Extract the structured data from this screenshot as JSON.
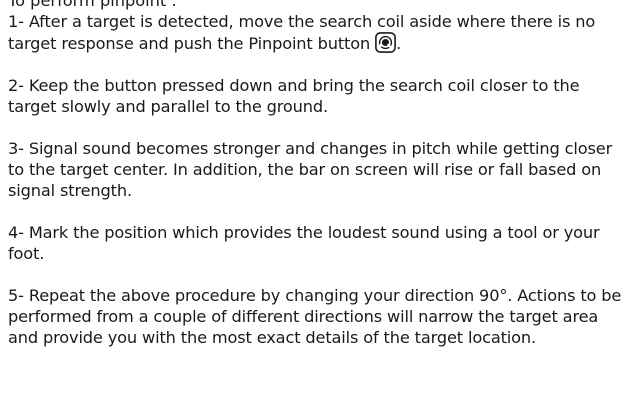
{
  "document": {
    "heading": "To perform pinpoint :",
    "steps": [
      {
        "text_before_icon": "1- After a target is detected, move the search coil aside where there is no target response and push the Pinpoint button",
        "icon": "pinpoint-button-icon",
        "text_after_icon": "."
      },
      {
        "text": "2- Keep the button pressed down and bring the search coil closer to the target slowly and parallel to the ground."
      },
      {
        "text": "3- Signal sound becomes stronger and changes in pitch while getting closer to the target center. In addition, the bar on screen will rise or fall based on signal strength."
      },
      {
        "text": "4- Mark the position which provides the loudest sound using a tool or your foot."
      },
      {
        "text": "5- Repeat the above procedure by changing your direction 90°. Actions to be performed from a couple of different directions will narrow the target area and provide you with the most exact details of the target location."
      }
    ]
  }
}
